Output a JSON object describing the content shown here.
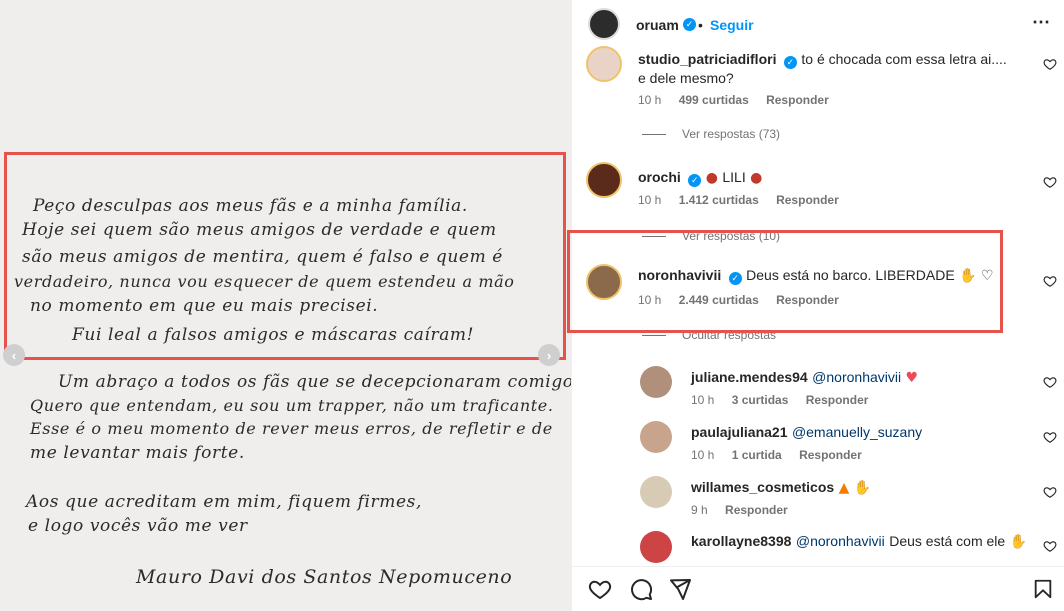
{
  "letter": {
    "lines": [
      "Peço desculpas aos meus fãs e a minha família.",
      "Hoje sei quem são meus amigos de verdade e quem",
      "são meus amigos de mentira, quem é falso e quem é",
      "verdadeiro, nunca vou esquecer de quem estendeu a mão",
      "no momento em que eu mais precisei.",
      "Fui leal a falsos amigos e máscaras caíram!",
      "Um abraço a todos os fãs que se decepcionaram comigo.",
      "Quero que entendam, eu sou um trapper, não um traficante.",
      "Esse é o meu momento de rever meus erros, de refletir e de",
      "me levantar mais forte.",
      "Aos que acreditam em mim, fiquem firmes,",
      "e logo vocês vão me ver",
      "Mauro Davi dos Santos Nepomuceno"
    ],
    "prev_arrow": "‹",
    "next_arrow": "›"
  },
  "header": {
    "username": "oruam",
    "dot": "•",
    "follow_label": "Seguir",
    "more_label": "⋯"
  },
  "comments": [
    {
      "username": "studio_patriciadiflori",
      "text": "to é chocada com essa letra ai.... e dele mesmo?",
      "time": "10 h",
      "likes": "499 curtidas",
      "reply": "Responder",
      "view_replies": "Ver respostas (73)"
    },
    {
      "username": "orochi",
      "text": "LILI",
      "time": "10 h",
      "likes": "1.412 curtidas",
      "reply": "Responder",
      "view_replies": "Ver respostas (10)"
    },
    {
      "username": "noronhavivii",
      "text": "Deus está no barco. LIBERDADE",
      "time": "10 h",
      "likes": "2.449 curtidas",
      "reply": "Responder",
      "hide_replies": "Ocultar respostas"
    }
  ],
  "replies": [
    {
      "username": "juliane.mendes94",
      "mention": "@noronhavivii",
      "text": "",
      "time": "10 h",
      "likes": "3 curtidas",
      "reply": "Responder"
    },
    {
      "username": "paulajuliana21",
      "mention": "@emanuelly_suzany",
      "text": "",
      "time": "10 h",
      "likes": "1 curtida",
      "reply": "Responder"
    },
    {
      "username": "willames_cosmeticos",
      "mention": "",
      "text": "",
      "time": "9 h",
      "likes": "",
      "reply": "Responder"
    },
    {
      "username": "karollayne8398",
      "mention": "@noronhavivii",
      "text": "Deus está com ele",
      "time": "",
      "likes": "",
      "reply": ""
    }
  ],
  "colors": {
    "accent": "#0095f6",
    "highlight": "#e5534b",
    "like_red": "#ed4956"
  }
}
